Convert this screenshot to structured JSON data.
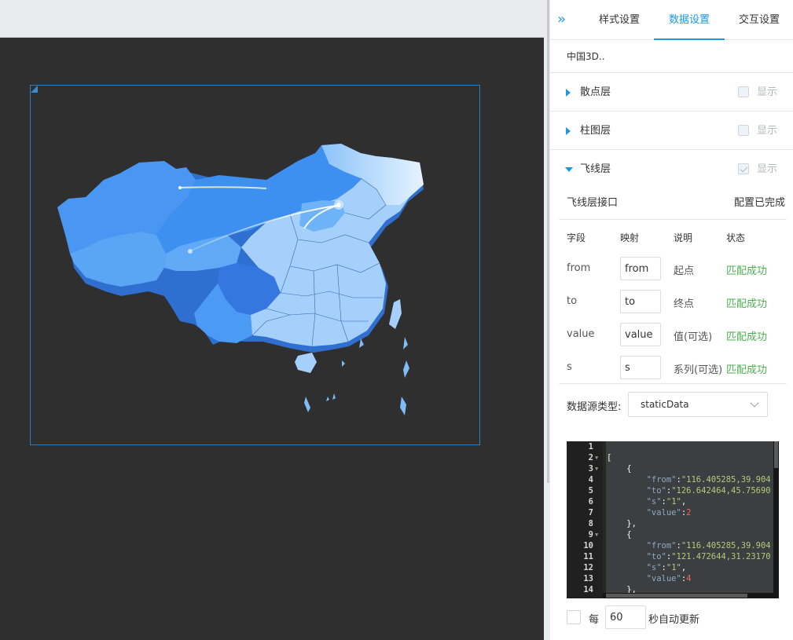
{
  "tabs": [
    {
      "label": "样式设置"
    },
    {
      "label": "数据设置"
    },
    {
      "label": "交互设置"
    }
  ],
  "active_tab": "数据设置",
  "component_name": "中国3D..",
  "layers": [
    {
      "name": "散点层",
      "show_label": "显示",
      "checked": false,
      "expanded": false
    },
    {
      "name": "柱图层",
      "show_label": "显示",
      "checked": false,
      "expanded": false
    },
    {
      "name": "飞线层",
      "show_label": "显示",
      "checked": true,
      "expanded": true
    }
  ],
  "fly_interface": {
    "label": "飞线层接口",
    "status": "配置已完成"
  },
  "field_headers": {
    "field": "字段",
    "mapping": "映射",
    "desc": "说明",
    "status": "状态"
  },
  "fields": [
    {
      "name": "from",
      "value": "from",
      "desc": "起点",
      "status": "匹配成功"
    },
    {
      "name": "to",
      "value": "to",
      "desc": "终点",
      "status": "匹配成功"
    },
    {
      "name": "value",
      "value": "value",
      "desc": "值(可选)",
      "status": "匹配成功"
    },
    {
      "name": "s",
      "value": "s",
      "desc": "系列(可选)",
      "status": "匹配成功"
    }
  ],
  "datasource": {
    "label": "数据源类型:",
    "selected": "staticData"
  },
  "editor": {
    "line_numbers": [
      "1",
      "2",
      "3",
      "4",
      "5",
      "6",
      "7",
      "8",
      "9",
      "10",
      "11",
      "12",
      "13",
      "14"
    ],
    "lines": [
      "",
      "[",
      "    {",
      "        \"from\":\"116.405285,39.904",
      "        \"to\":\"126.642464,45.75690",
      "        \"s\":\"1\",",
      "        \"value\":2",
      "    },",
      "    {",
      "        \"from\":\"116.405285,39.904",
      "        \"to\":\"121.472644,31.23170",
      "        \"s\":\"1\",",
      "        \"value\":4",
      "    },"
    ]
  },
  "auto_update": {
    "prefix": "每",
    "seconds": "60",
    "suffix": "秒自动更新",
    "checked": false
  },
  "colors": {
    "accent": "#1a9ae0",
    "success": "#4caf50",
    "canvas": "#2f2f2f",
    "map_dark": "#3a7fe8",
    "map_light": "#a8d4fb"
  }
}
